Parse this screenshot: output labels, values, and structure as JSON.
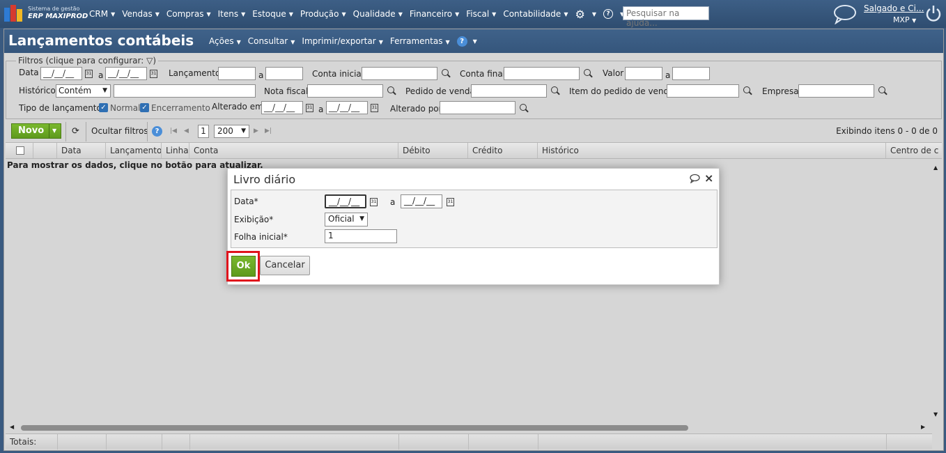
{
  "topbar": {
    "brand_line1": "Sistema de gestão",
    "brand_line2": "ERP MAXIPROD",
    "nav": [
      "CRM",
      "Vendas",
      "Compras",
      "Itens",
      "Estoque",
      "Produção",
      "Qualidade",
      "Financeiro",
      "Fiscal",
      "Contabilidade"
    ],
    "search_placeholder": "Pesquisar na ajuda...",
    "user": "Salgado e Ci...",
    "company": "MXP"
  },
  "page": {
    "title": "Lançamentos contábeis",
    "menu": [
      "Ações",
      "Consultar",
      "Imprimir/exportar",
      "Ferramentas"
    ]
  },
  "filters": {
    "legend": "Filtros (clique para configurar:",
    "data_label": "Data",
    "date_mask": "__/__/__",
    "a": "a",
    "lancamento_label": "Lançamento",
    "conta_inicial_label": "Conta inicial",
    "conta_final_label": "Conta final",
    "valor_label": "Valor",
    "historico_label": "Histórico",
    "historico_mode": "Contém",
    "nota_fiscal_label": "Nota fiscal",
    "pedido_venda_label": "Pedido de venda",
    "item_pedido_label": "Item do pedido de venda",
    "empresa_label": "Empresa",
    "tipo_label": "Tipo de lançamento",
    "tipo_normal": "Normal",
    "tipo_encerramento": "Encerramento",
    "alterado_em_label": "Alterado em",
    "alterado_por_label": "Alterado por"
  },
  "toolbar": {
    "novo": "Novo",
    "ocultar": "Ocultar filtros",
    "page": "1",
    "page_size": "200",
    "status": "Exibindo itens 0 - 0 de 0"
  },
  "grid": {
    "columns": [
      "Data",
      "Lançamento",
      "Linha",
      "Conta",
      "Débito",
      "Crédito",
      "Histórico",
      "Centro de c"
    ],
    "empty_message": "Para mostrar os dados, clique no botão para atualizar.",
    "totals_label": "Totais:"
  },
  "dialog": {
    "title": "Livro diário",
    "data_label": "Data*",
    "date_mask": "__/__/__",
    "a": "a",
    "exibicao_label": "Exibição*",
    "exibicao_value": "Oficial",
    "folha_label": "Folha inicial*",
    "folha_value": "1",
    "ok": "Ok",
    "cancel": "Cancelar"
  },
  "colors": {
    "header_blue": "#35567c",
    "accent_green": "#6aa823",
    "highlight_red": "#e0131c"
  }
}
